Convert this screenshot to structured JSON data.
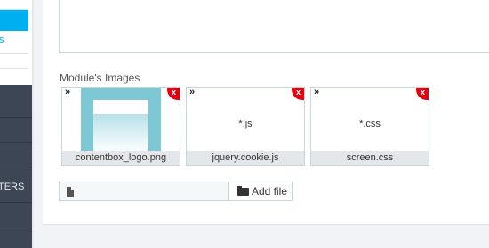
{
  "sidebar": {
    "submenu_fragment": "s",
    "section_fragment": "TERS"
  },
  "module_images": {
    "label": "Module's Images",
    "move_handle_glyph": "»",
    "delete_glyph": "x",
    "images": [
      {
        "filename": "contentbox_logo.png",
        "preview": "image",
        "icon": "logo-thumbnail"
      },
      {
        "filename": "jquery.cookie.js",
        "preview_text": "*.js"
      },
      {
        "filename": "screen.css",
        "preview_text": "*.css"
      }
    ]
  },
  "upload": {
    "add_file_label": "Add file",
    "file_icon": "file-icon",
    "folder_icon": "folder-open-icon"
  },
  "colors": {
    "accent": "#00aff0",
    "delete": "#e3000f",
    "sidebar_dark": "#3c4654"
  }
}
